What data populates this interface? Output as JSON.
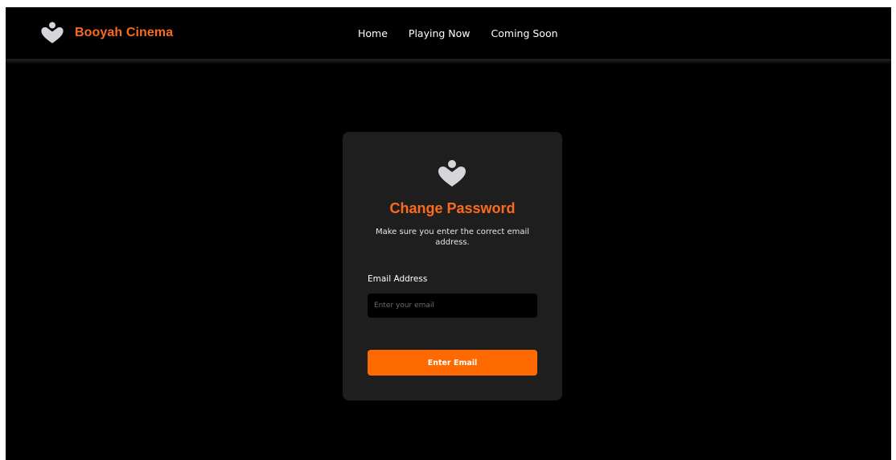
{
  "colors": {
    "accent": "#fb6a1d",
    "button": "#ff6a00",
    "background": "#000000",
    "card": "#1e1e1e",
    "logo": "#d6d6da"
  },
  "header": {
    "brand_name": "Booyah Cinema",
    "logo_icon": "heart-person-logo-icon",
    "nav": [
      {
        "label": "Home"
      },
      {
        "label": "Playing Now"
      },
      {
        "label": "Coming Soon"
      }
    ]
  },
  "form": {
    "logo_icon": "heart-person-logo-icon",
    "title": "Change Password",
    "subtitle": "Make sure you enter the correct email address.",
    "email_label": "Email Address",
    "email_placeholder": "Enter your email",
    "email_value": "",
    "submit_label": "Enter Email"
  }
}
